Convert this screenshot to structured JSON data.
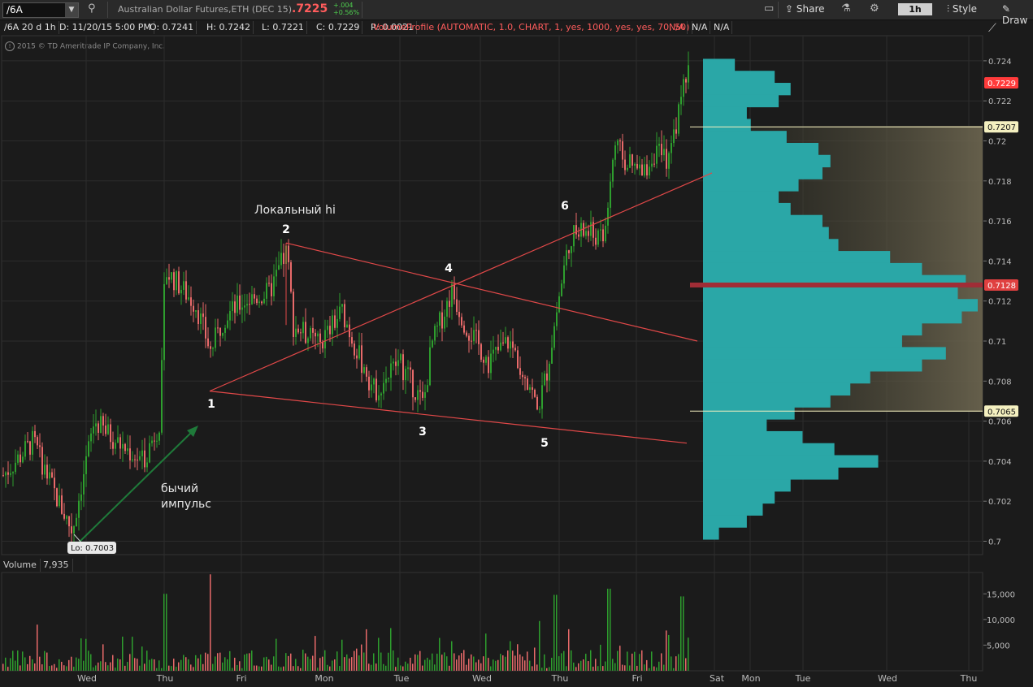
{
  "toolbar": {
    "symbol": "/6A",
    "description": "Australian Dollar Futures,ETH (DEC 15)",
    "last_price": ".7225",
    "change_abs": "+.004",
    "change_pct": "+0.56%",
    "share_label": "Share",
    "timeframe": "1h",
    "style_label": "Style",
    "drawings_label": "Draw"
  },
  "infobar": {
    "chart_label": "/6A 20 d 1h",
    "date": "D: 11/20/15 5:00 PM",
    "open": "O: 0.7241",
    "high": "H: 0.7242",
    "low": "L: 0.7221",
    "close": "C: 0.7229",
    "range": "R: 0.0021",
    "volume_profile": "VolumeProfile (AUTOMATIC, 1.0, CHART, 1, yes, 1000, yes, yes, 70, 50)",
    "na1": "N/A",
    "na2": "N/A",
    "na3": "N/A"
  },
  "copyright": "2015 © TD Ameritrade IP Company, Inc.",
  "price_axis": {
    "ticks": [
      "0.724",
      "0.722",
      "0.72",
      "0.718",
      "0.716",
      "0.714",
      "0.712",
      "0.71",
      "0.708",
      "0.706",
      "0.704",
      "0.702",
      "0.7"
    ],
    "markers": [
      {
        "label": "0.7229",
        "color": "#ff3b3b",
        "text_color": "#ffffff"
      },
      {
        "label": "0.7207",
        "color": "#f4f0c0",
        "text_color": "#111111"
      },
      {
        "label": "0.7128",
        "color": "#e04040",
        "text_color": "#ffffff"
      },
      {
        "label": "0.7065",
        "color": "#f4f0c0",
        "text_color": "#111111"
      }
    ]
  },
  "time_axis": [
    "Wed",
    "Thu",
    "Fri",
    "Mon",
    "Tue",
    "Wed",
    "Thu",
    "Fri",
    "Sat",
    "Mon",
    "Tue",
    "Wed",
    "Thu"
  ],
  "annotations": {
    "wave_labels": [
      "1",
      "2",
      "3",
      "4",
      "5",
      "6"
    ],
    "local_high": "Локальный hi",
    "impulse_line1": "бычий",
    "impulse_line2": "импульс",
    "low_bubble": "Lo: 0.7003"
  },
  "volume": {
    "title": "Volume",
    "value": "7,935",
    "ticks": [
      "15,000",
      "10,000",
      "5,000"
    ]
  },
  "colors": {
    "bull": "#2e9e2e",
    "bear": "#e86a6a",
    "trendline": "#e04848",
    "profile": "#2aa7a7",
    "arrow": "#1f7a3a"
  },
  "chart_data": {
    "type": "candlestick",
    "price_range": [
      0.6993,
      0.7247
    ],
    "volume_range": [
      0,
      19000
    ],
    "wave_points": [
      {
        "label": "1",
        "price": 0.7075
      },
      {
        "label": "2",
        "price": 0.7149
      },
      {
        "label": "3",
        "price": 0.7063
      },
      {
        "label": "4",
        "price": 0.7129
      },
      {
        "label": "5",
        "price": 0.7055
      },
      {
        "label": "6",
        "price": 0.7156
      }
    ],
    "value_area": {
      "high": 0.7207,
      "poc": 0.7128,
      "low": 0.7065
    },
    "last": 0.7229,
    "low": 0.7003
  }
}
